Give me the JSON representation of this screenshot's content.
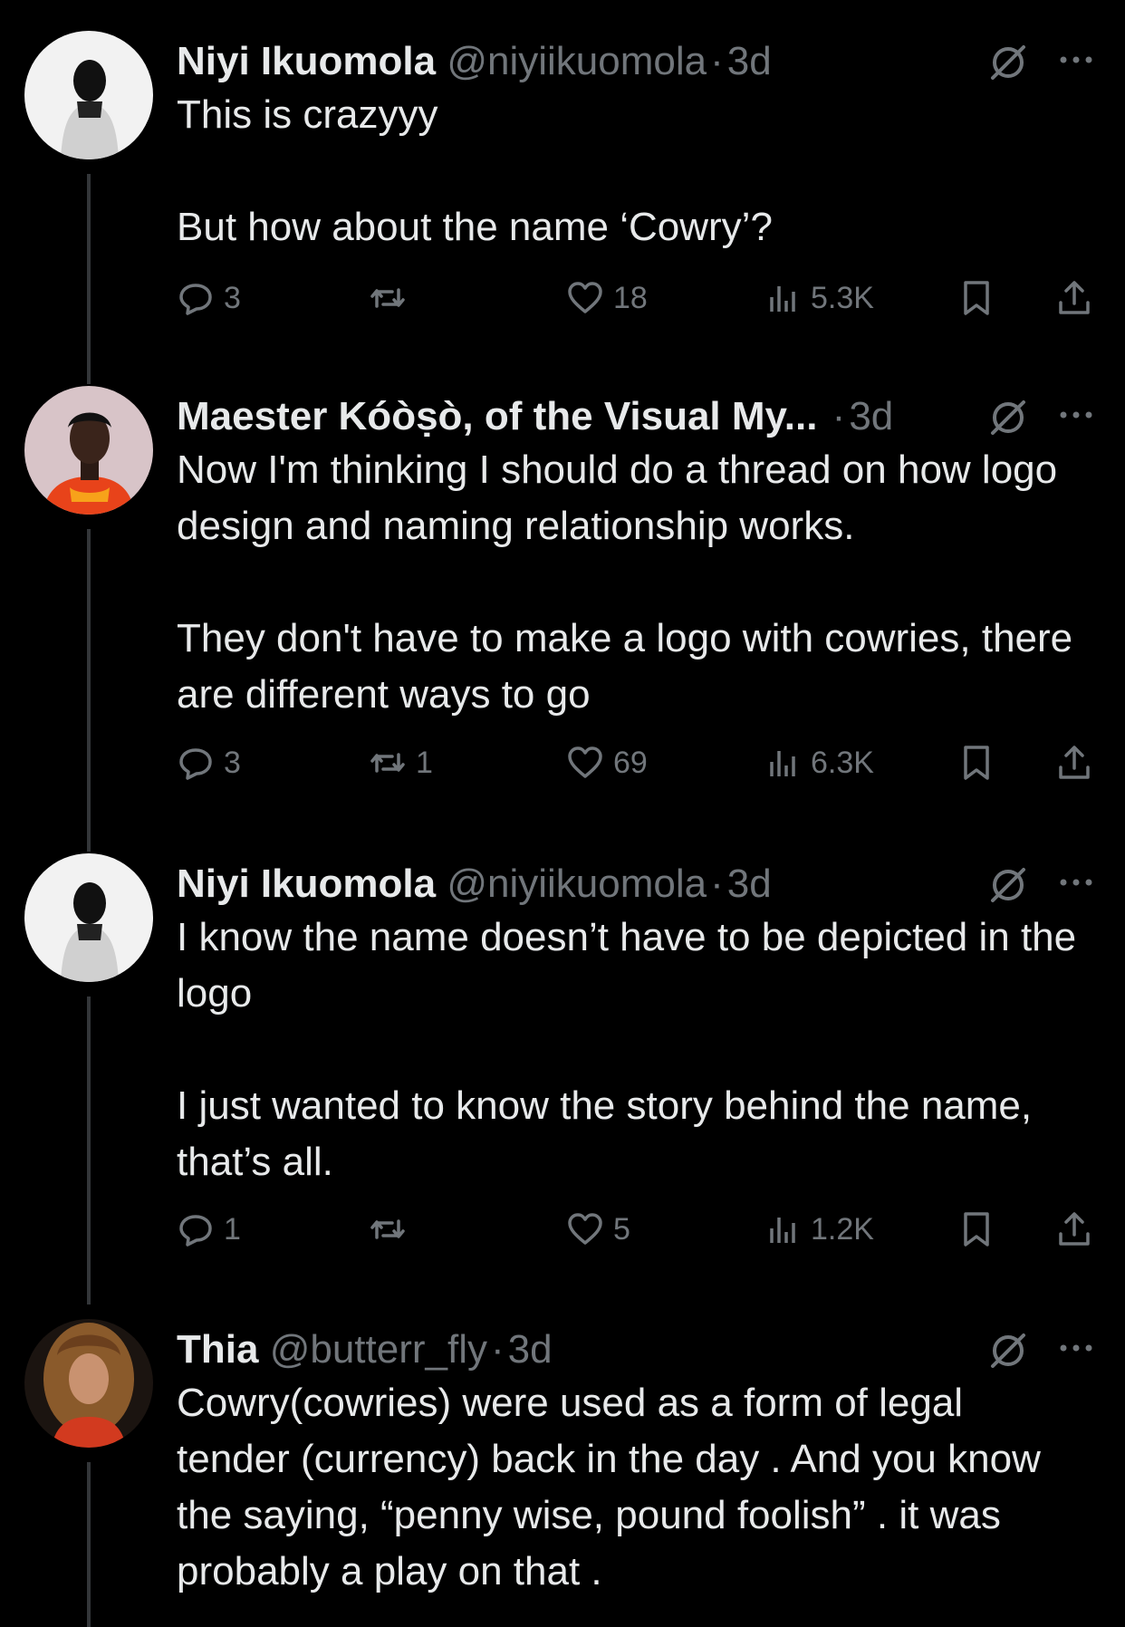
{
  "posts": [
    {
      "author": "Niyi Ikuomola",
      "handle": "@niyiikuomola",
      "time": "3d",
      "text": "This is crazyyy\n\nBut how about the name ‘Cowry’?",
      "replies": "3",
      "reposts": "",
      "likes": "18",
      "views": "5.3K"
    },
    {
      "author": "Maester Kóòṣò, of the Visual My...",
      "handle": "",
      "time": "3d",
      "text": "Now I'm thinking I should do a thread on how logo design and naming relationship works.\n\nThey don't have to make a logo with cowries, there are different ways to go",
      "replies": "3",
      "reposts": "1",
      "likes": "69",
      "views": "6.3K"
    },
    {
      "author": "Niyi Ikuomola",
      "handle": "@niyiikuomola",
      "time": "3d",
      "text": "I know the name doesn’t have to be depicted in the logo\n\nI just wanted to know the story behind the name, that’s all.",
      "replies": "1",
      "reposts": "",
      "likes": "5",
      "views": "1.2K"
    },
    {
      "author": "Thia",
      "handle": "@butterr_fly",
      "time": "3d",
      "text": "Cowry(cowries) were used as a form of legal tender (currency) back in the day . And you know the saying, “penny wise, pound foolish” . it was probably a play on that ."
    }
  ],
  "separator": "·",
  "icons": [
    "reply-icon",
    "repost-icon",
    "like-icon",
    "views-icon",
    "bookmark-icon",
    "share-icon",
    "grok-icon",
    "more-icon"
  ]
}
